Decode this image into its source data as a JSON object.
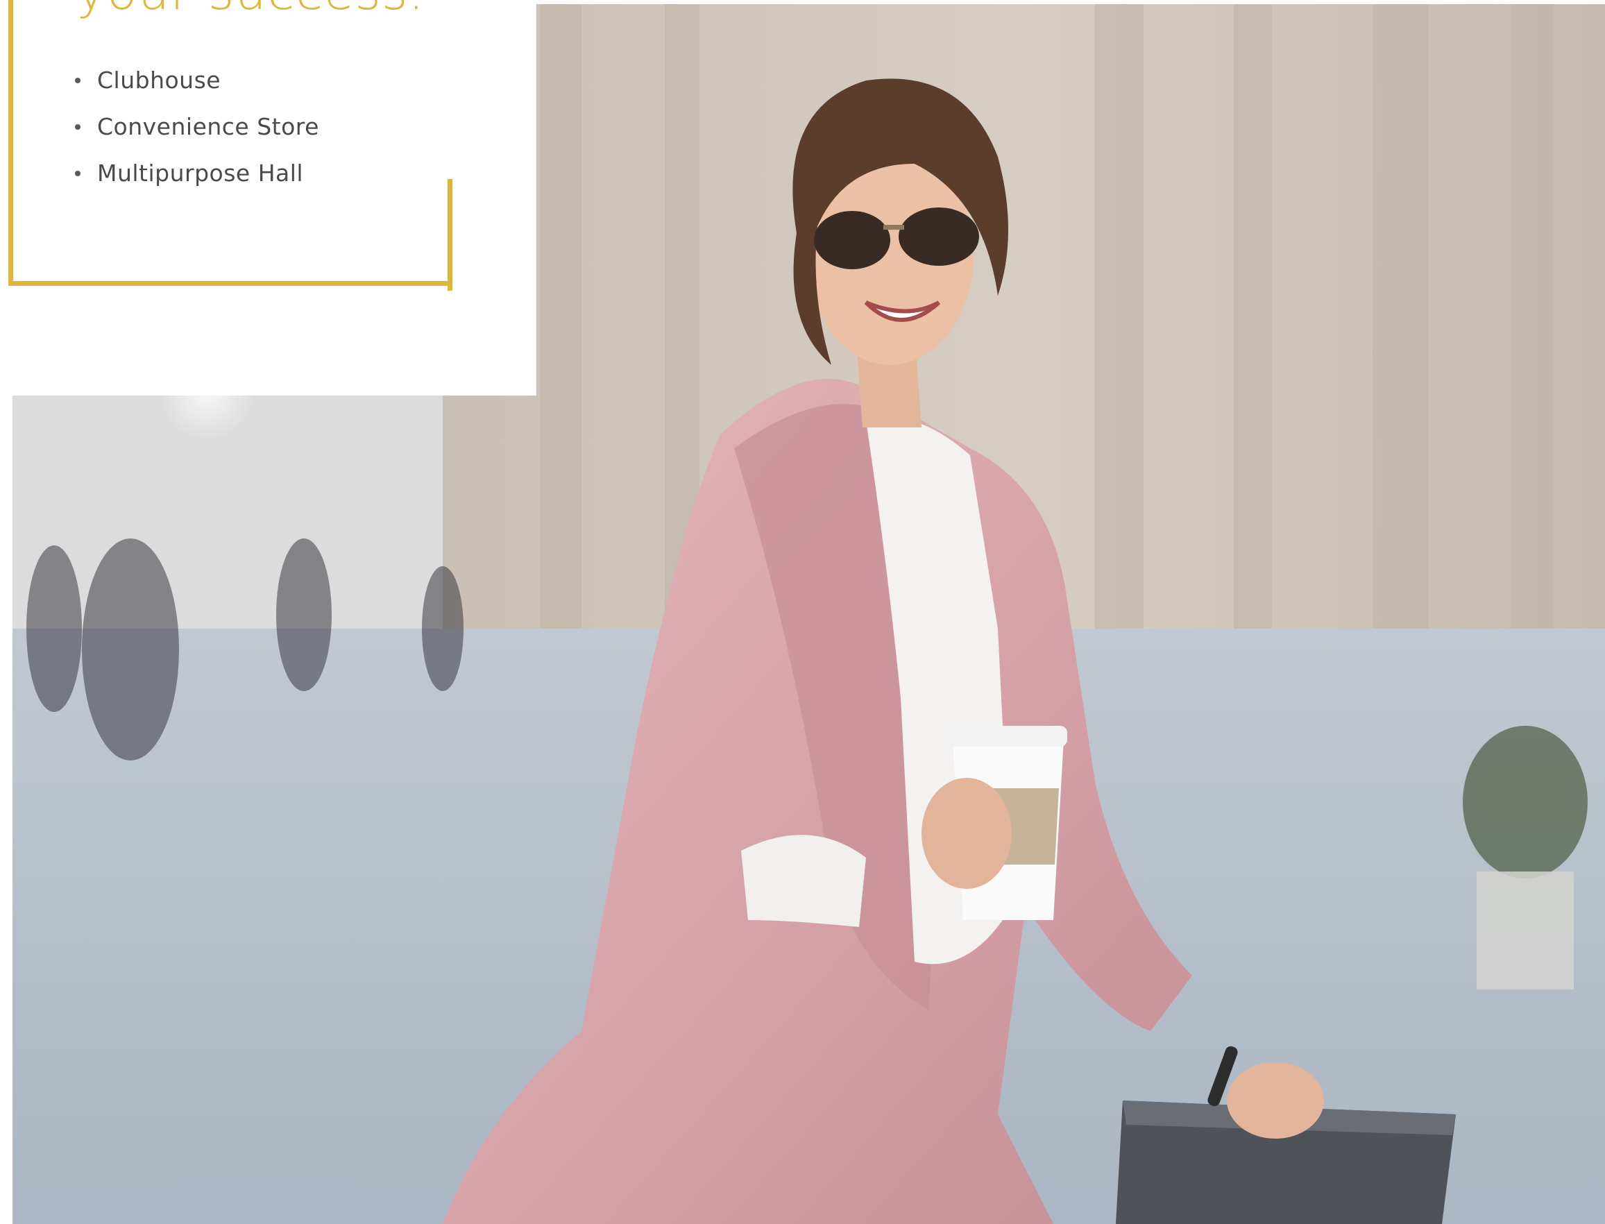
{
  "card": {
    "headline": "your success.",
    "amenities": [
      "Clubhouse",
      "Convenience Store",
      "Multipurpose Hall"
    ]
  },
  "photo": {
    "subject": "woman-in-pink-coat-with-coffee-photo"
  },
  "colors": {
    "accent": "#dfb637",
    "text": "#4a4a4a",
    "background": "#ffffff",
    "coat": "#d8a7ad"
  }
}
